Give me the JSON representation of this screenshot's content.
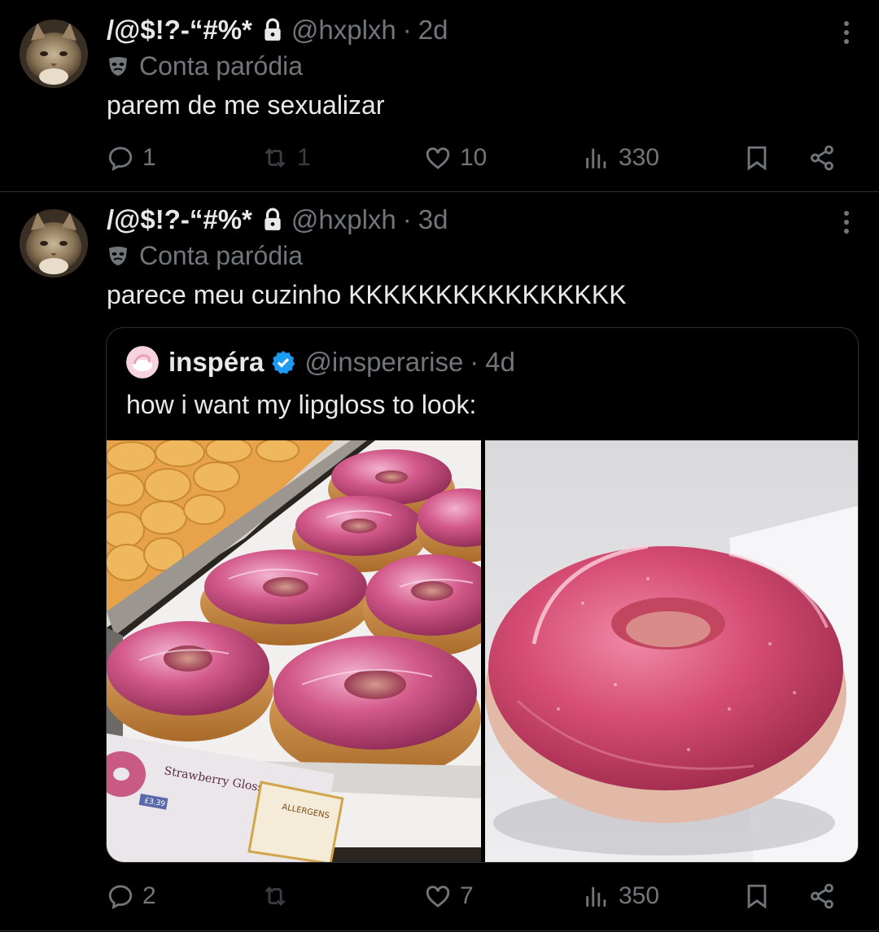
{
  "tweets": [
    {
      "display_name": "/@$!?-“#%*",
      "handle": "@hxplxh",
      "time": "2d",
      "parody_label": "Conta paródia",
      "text": "parem de me sexualizar",
      "stats": {
        "replies": "1",
        "reposts": "1",
        "likes": "10",
        "views": "330"
      }
    },
    {
      "display_name": "/@$!?-“#%*",
      "handle": "@hxplxh",
      "time": "3d",
      "parody_label": "Conta paródia",
      "text": "parece meu cuzinho KKKKKKKKKKKKKKKK",
      "quote": {
        "display_name": "inspéra",
        "handle": "@insperarise",
        "time": "4d",
        "text": "how i want my lipgloss to look:",
        "sign": {
          "title": "Strawberry Gloss",
          "price": "£3.39",
          "allergens": "ALLERGENS"
        }
      },
      "stats": {
        "replies": "2",
        "reposts": "",
        "likes": "7",
        "views": "350"
      }
    }
  ],
  "separator": "·",
  "colors": {
    "background": "#000000",
    "text": "#e7e9ea",
    "secondary": "#71767b",
    "border": "#2f3336",
    "verified": "#1d9bf0"
  },
  "icons": [
    "lock-icon",
    "more-icon",
    "mask-icon",
    "reply-icon",
    "retweet-icon",
    "like-icon",
    "views-icon",
    "bookmark-icon",
    "share-icon",
    "verified-icon"
  ]
}
